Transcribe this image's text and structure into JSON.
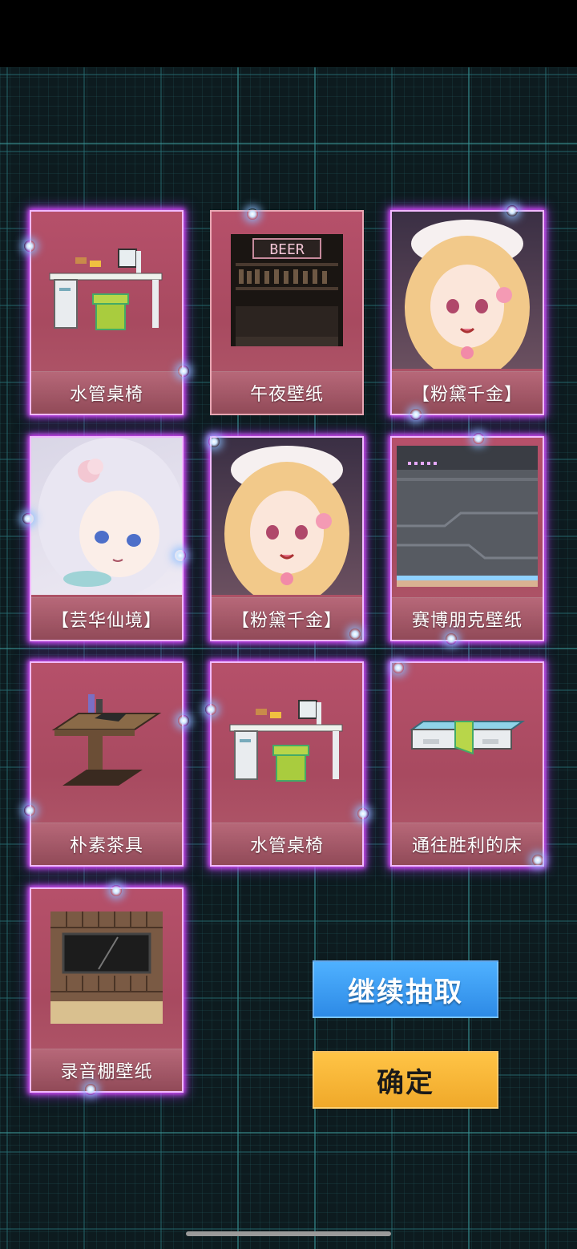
{
  "cards": [
    {
      "label": "水管桌椅",
      "art": "pipe-desk-icon"
    },
    {
      "label": "午夜壁纸",
      "art": "bar-wallpaper-icon",
      "sign": "BEER"
    },
    {
      "label": "【粉黛千金】",
      "art": "blonde-maid-portrait"
    },
    {
      "label": "【芸华仙境】",
      "art": "silver-hair-portrait"
    },
    {
      "label": "【粉黛千金】",
      "art": "blonde-maid-portrait"
    },
    {
      "label": "赛博朋克壁纸",
      "art": "cyber-wallpaper-icon"
    },
    {
      "label": "朴素茶具",
      "art": "tea-table-icon"
    },
    {
      "label": "水管桌椅",
      "art": "pipe-desk-icon"
    },
    {
      "label": "通往胜利的床",
      "art": "bed-icon"
    },
    {
      "label": "录音棚壁纸",
      "art": "studio-wallpaper-icon"
    }
  ],
  "buttons": {
    "continue_label": "继续抽取",
    "confirm_label": "确定"
  },
  "colors": {
    "card_bg": "#b6506a",
    "glow": "#d94dff",
    "continue_bg": "#3b9df4",
    "confirm_bg": "#f7b637"
  }
}
